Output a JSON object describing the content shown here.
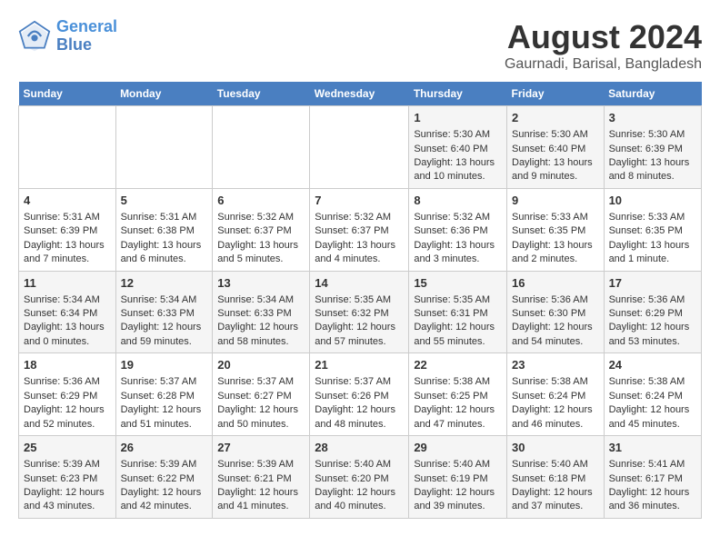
{
  "logo": {
    "line1": "General",
    "line2": "Blue"
  },
  "title": "August 2024",
  "subtitle": "Gaurnadi, Barisal, Bangladesh",
  "days_of_week": [
    "Sunday",
    "Monday",
    "Tuesday",
    "Wednesday",
    "Thursday",
    "Friday",
    "Saturday"
  ],
  "weeks": [
    [
      {
        "day": "",
        "content": ""
      },
      {
        "day": "",
        "content": ""
      },
      {
        "day": "",
        "content": ""
      },
      {
        "day": "",
        "content": ""
      },
      {
        "day": "1",
        "content": "Sunrise: 5:30 AM\nSunset: 6:40 PM\nDaylight: 13 hours\nand 10 minutes."
      },
      {
        "day": "2",
        "content": "Sunrise: 5:30 AM\nSunset: 6:40 PM\nDaylight: 13 hours\nand 9 minutes."
      },
      {
        "day": "3",
        "content": "Sunrise: 5:30 AM\nSunset: 6:39 PM\nDaylight: 13 hours\nand 8 minutes."
      }
    ],
    [
      {
        "day": "4",
        "content": "Sunrise: 5:31 AM\nSunset: 6:39 PM\nDaylight: 13 hours\nand 7 minutes."
      },
      {
        "day": "5",
        "content": "Sunrise: 5:31 AM\nSunset: 6:38 PM\nDaylight: 13 hours\nand 6 minutes."
      },
      {
        "day": "6",
        "content": "Sunrise: 5:32 AM\nSunset: 6:37 PM\nDaylight: 13 hours\nand 5 minutes."
      },
      {
        "day": "7",
        "content": "Sunrise: 5:32 AM\nSunset: 6:37 PM\nDaylight: 13 hours\nand 4 minutes."
      },
      {
        "day": "8",
        "content": "Sunrise: 5:32 AM\nSunset: 6:36 PM\nDaylight: 13 hours\nand 3 minutes."
      },
      {
        "day": "9",
        "content": "Sunrise: 5:33 AM\nSunset: 6:35 PM\nDaylight: 13 hours\nand 2 minutes."
      },
      {
        "day": "10",
        "content": "Sunrise: 5:33 AM\nSunset: 6:35 PM\nDaylight: 13 hours\nand 1 minute."
      }
    ],
    [
      {
        "day": "11",
        "content": "Sunrise: 5:34 AM\nSunset: 6:34 PM\nDaylight: 13 hours\nand 0 minutes."
      },
      {
        "day": "12",
        "content": "Sunrise: 5:34 AM\nSunset: 6:33 PM\nDaylight: 12 hours\nand 59 minutes."
      },
      {
        "day": "13",
        "content": "Sunrise: 5:34 AM\nSunset: 6:33 PM\nDaylight: 12 hours\nand 58 minutes."
      },
      {
        "day": "14",
        "content": "Sunrise: 5:35 AM\nSunset: 6:32 PM\nDaylight: 12 hours\nand 57 minutes."
      },
      {
        "day": "15",
        "content": "Sunrise: 5:35 AM\nSunset: 6:31 PM\nDaylight: 12 hours\nand 55 minutes."
      },
      {
        "day": "16",
        "content": "Sunrise: 5:36 AM\nSunset: 6:30 PM\nDaylight: 12 hours\nand 54 minutes."
      },
      {
        "day": "17",
        "content": "Sunrise: 5:36 AM\nSunset: 6:29 PM\nDaylight: 12 hours\nand 53 minutes."
      }
    ],
    [
      {
        "day": "18",
        "content": "Sunrise: 5:36 AM\nSunset: 6:29 PM\nDaylight: 12 hours\nand 52 minutes."
      },
      {
        "day": "19",
        "content": "Sunrise: 5:37 AM\nSunset: 6:28 PM\nDaylight: 12 hours\nand 51 minutes."
      },
      {
        "day": "20",
        "content": "Sunrise: 5:37 AM\nSunset: 6:27 PM\nDaylight: 12 hours\nand 50 minutes."
      },
      {
        "day": "21",
        "content": "Sunrise: 5:37 AM\nSunset: 6:26 PM\nDaylight: 12 hours\nand 48 minutes."
      },
      {
        "day": "22",
        "content": "Sunrise: 5:38 AM\nSunset: 6:25 PM\nDaylight: 12 hours\nand 47 minutes."
      },
      {
        "day": "23",
        "content": "Sunrise: 5:38 AM\nSunset: 6:24 PM\nDaylight: 12 hours\nand 46 minutes."
      },
      {
        "day": "24",
        "content": "Sunrise: 5:38 AM\nSunset: 6:24 PM\nDaylight: 12 hours\nand 45 minutes."
      }
    ],
    [
      {
        "day": "25",
        "content": "Sunrise: 5:39 AM\nSunset: 6:23 PM\nDaylight: 12 hours\nand 43 minutes."
      },
      {
        "day": "26",
        "content": "Sunrise: 5:39 AM\nSunset: 6:22 PM\nDaylight: 12 hours\nand 42 minutes."
      },
      {
        "day": "27",
        "content": "Sunrise: 5:39 AM\nSunset: 6:21 PM\nDaylight: 12 hours\nand 41 minutes."
      },
      {
        "day": "28",
        "content": "Sunrise: 5:40 AM\nSunset: 6:20 PM\nDaylight: 12 hours\nand 40 minutes."
      },
      {
        "day": "29",
        "content": "Sunrise: 5:40 AM\nSunset: 6:19 PM\nDaylight: 12 hours\nand 39 minutes."
      },
      {
        "day": "30",
        "content": "Sunrise: 5:40 AM\nSunset: 6:18 PM\nDaylight: 12 hours\nand 37 minutes."
      },
      {
        "day": "31",
        "content": "Sunrise: 5:41 AM\nSunset: 6:17 PM\nDaylight: 12 hours\nand 36 minutes."
      }
    ]
  ]
}
